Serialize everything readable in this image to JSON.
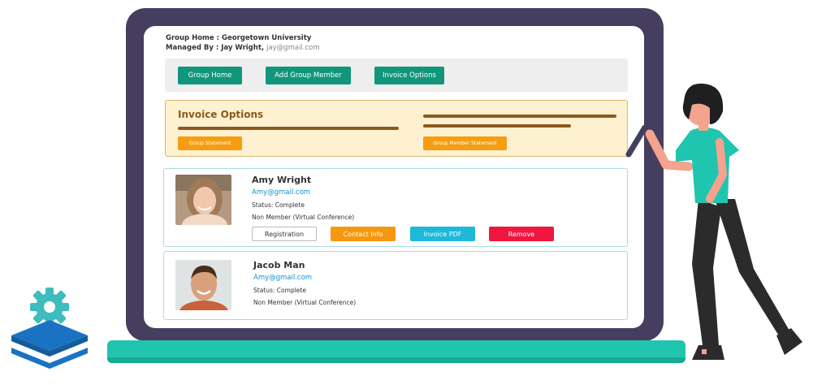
{
  "header": {
    "group_home_line": "Group Home : Georgetown University",
    "managed_by_label": "Managed By : Jay Wright,",
    "managed_by_email": "jay@gmail.com"
  },
  "toolbar": {
    "buttons": [
      "Group Home",
      "Add Group Member",
      "Invoice Options"
    ]
  },
  "invoice_options": {
    "title": "Invoice Options",
    "group_statement_label": "Group Statement",
    "group_member_statement_label": "Group Member Statement"
  },
  "members": [
    {
      "name": "Amy Wright",
      "email": "Amy@gmail.com",
      "status": "Status: Complete",
      "membership": "Non Member (Virtual Conference)",
      "actions": {
        "registration": "Registration",
        "contact_info": "Contact Info",
        "invoice_pdf": "Invoice PDF",
        "remove": "Remove"
      }
    },
    {
      "name": "Jacob Man",
      "email": "Amy@gmail.com",
      "status": "Status: Complete",
      "membership": "Non Member (Virtual Conference)"
    }
  ],
  "colors": {
    "laptop_frame": "#453e5e",
    "laptop_base": "#20c5b0",
    "primary_button": "#11967c",
    "invoice_panel_bg": "#fdf1d0",
    "invoice_panel_border": "#dbb86d",
    "accent_orange": "#f69d12",
    "link_blue": "#0e8fcf",
    "invoice_pdf_button": "#1eb8d9",
    "remove_button": "#f0163f",
    "card_border": "#a7dde3"
  },
  "icons": {
    "logo": "gear-stack-icon",
    "pen": "stylus-pen-icon"
  }
}
